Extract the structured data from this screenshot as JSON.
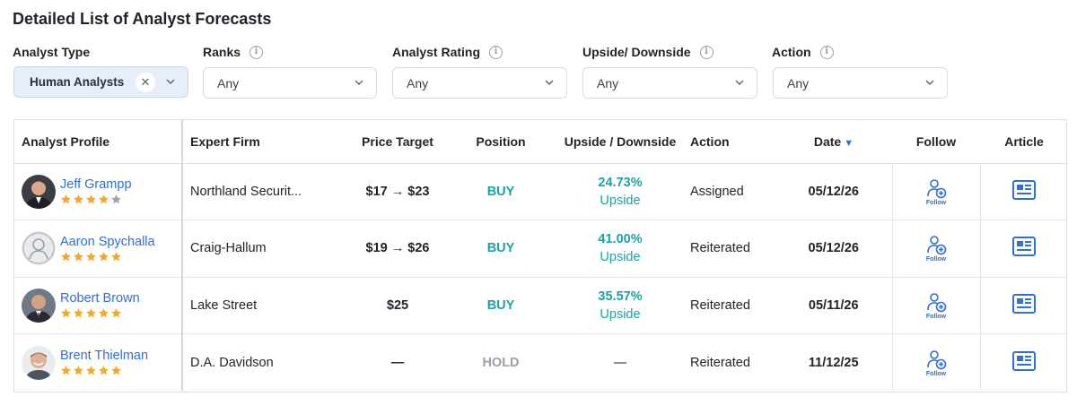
{
  "title": "Detailed List of Analyst Forecasts",
  "filters": {
    "analyst_type": {
      "label": "Analyst Type",
      "value": "Human Analysts"
    },
    "ranks": {
      "label": "Ranks",
      "value": "Any"
    },
    "analyst_rating": {
      "label": "Analyst Rating",
      "value": "Any"
    },
    "upside_downside": {
      "label": "Upside/ Downside",
      "value": "Any"
    },
    "action": {
      "label": "Action",
      "value": "Any"
    }
  },
  "table": {
    "headers": {
      "profile": "Analyst Profile",
      "firm": "Expert Firm",
      "price_target": "Price Target",
      "position": "Position",
      "upside": "Upside / Downside",
      "action": "Action",
      "date": "Date",
      "follow": "Follow",
      "article": "Article"
    },
    "follow_label": "Follow",
    "rows": [
      {
        "name": "Jeff Grampp",
        "stars": 4,
        "firm": "Northland Securit...",
        "price_target": "$17 → $23",
        "position": "BUY",
        "upside_pct": "24.73%",
        "upside_label": "Upside",
        "action": "Assigned",
        "date": "05/12/26",
        "avatar": "person-photo"
      },
      {
        "name": "Aaron Spychalla",
        "stars": 5,
        "firm": "Craig-Hallum",
        "price_target": "$19 → $26",
        "position": "BUY",
        "upside_pct": "41.00%",
        "upside_label": "Upside",
        "action": "Reiterated",
        "date": "05/12/26",
        "avatar": "placeholder"
      },
      {
        "name": "Robert Brown",
        "stars": 5,
        "firm": "Lake Street",
        "price_target": "$25",
        "position": "BUY",
        "upside_pct": "35.57%",
        "upside_label": "Upside",
        "action": "Reiterated",
        "date": "05/11/26",
        "avatar": "person-photo"
      },
      {
        "name": "Brent Thielman",
        "stars": 5,
        "firm": "D.A. Davidson",
        "price_target": "—",
        "position": "HOLD",
        "upside_pct": "—",
        "upside_label": "",
        "action": "Reiterated",
        "date": "11/12/25",
        "avatar": "person-photo"
      }
    ]
  },
  "colors": {
    "link": "#2f6fd6",
    "buy": "#1aa3a0",
    "hold": "#9aa0a6",
    "star_on": "#f5a623",
    "star_off": "#a0a4aa",
    "chip_bg": "#e6eef9"
  }
}
